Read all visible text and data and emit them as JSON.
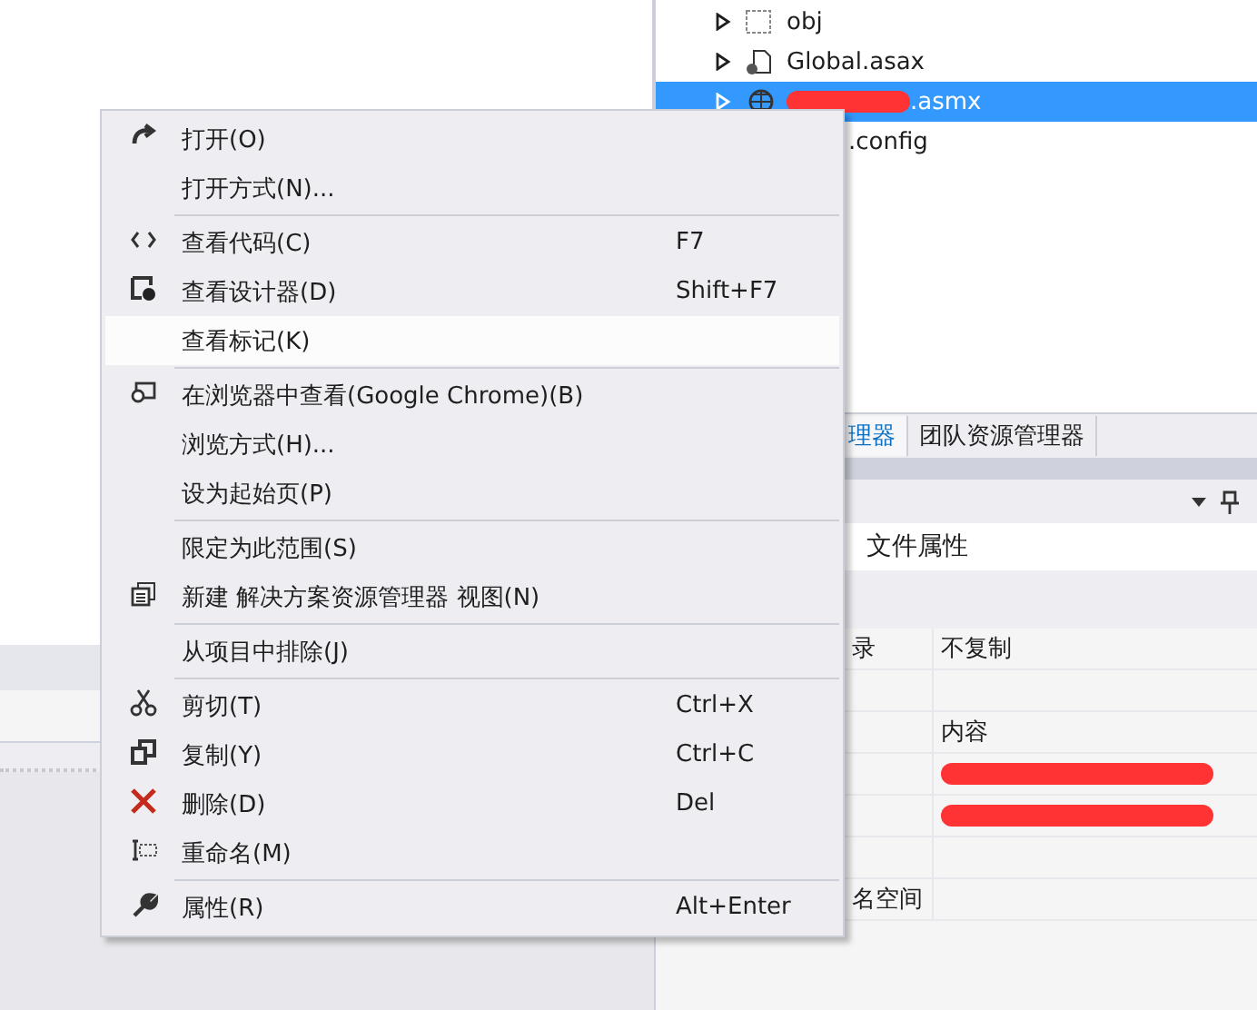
{
  "solution_explorer": {
    "rows": [
      {
        "label": "obj",
        "expanded": false,
        "selected": false
      },
      {
        "label": "Global.asax",
        "expanded": false,
        "selected": false
      },
      {
        "label": ".asmx",
        "expanded": false,
        "selected": true,
        "redacted": true
      },
      {
        "label": ".config",
        "selected": false
      }
    ]
  },
  "panel_tabs": [
    {
      "label": "理器",
      "selected": true
    },
    {
      "label": "团队资源管理器",
      "selected": false
    }
  ],
  "properties": {
    "title": "文件属性",
    "rows": [
      {
        "name": "录",
        "value": "不复制"
      },
      {
        "name": "",
        "value": ""
      },
      {
        "name": "",
        "value": "内容"
      },
      {
        "name": "",
        "value": "",
        "redacted": true
      },
      {
        "name": "",
        "value": "",
        "redacted": true
      },
      {
        "name": "",
        "value": ""
      },
      {
        "name": "名空间",
        "value": ""
      }
    ]
  },
  "context_menu": {
    "groups": [
      [
        {
          "label": "打开(O)",
          "selected": false
        },
        {
          "label": "打开方式(N)...",
          "selected": false
        }
      ],
      [
        {
          "label": "查看代码(C)",
          "shortcut": "F7",
          "selected": false
        },
        {
          "label": "查看设计器(D)",
          "shortcut": "Shift+F7",
          "selected": false
        },
        {
          "label": "查看标记(K)",
          "selected": true
        }
      ],
      [
        {
          "label": "在浏览器中查看(Google Chrome)(B)",
          "selected": false
        },
        {
          "label": "浏览方式(H)...",
          "selected": false
        },
        {
          "label": "设为起始页(P)",
          "selected": false
        }
      ],
      [
        {
          "label": "限定为此范围(S)",
          "selected": false
        },
        {
          "label": "新建 解决方案资源管理器 视图(N)",
          "selected": false
        }
      ],
      [
        {
          "label": "从项目中排除(J)",
          "selected": false
        }
      ],
      [
        {
          "label": "剪切(T)",
          "shortcut": "Ctrl+X",
          "selected": false
        },
        {
          "label": "复制(Y)",
          "shortcut": "Ctrl+C",
          "selected": false
        },
        {
          "label": "删除(D)",
          "shortcut": "Del",
          "selected": false
        },
        {
          "label": "重命名(M)",
          "selected": false
        }
      ],
      [
        {
          "label": "属性(R)",
          "shortcut": "Alt+Enter",
          "selected": false
        }
      ]
    ]
  }
}
